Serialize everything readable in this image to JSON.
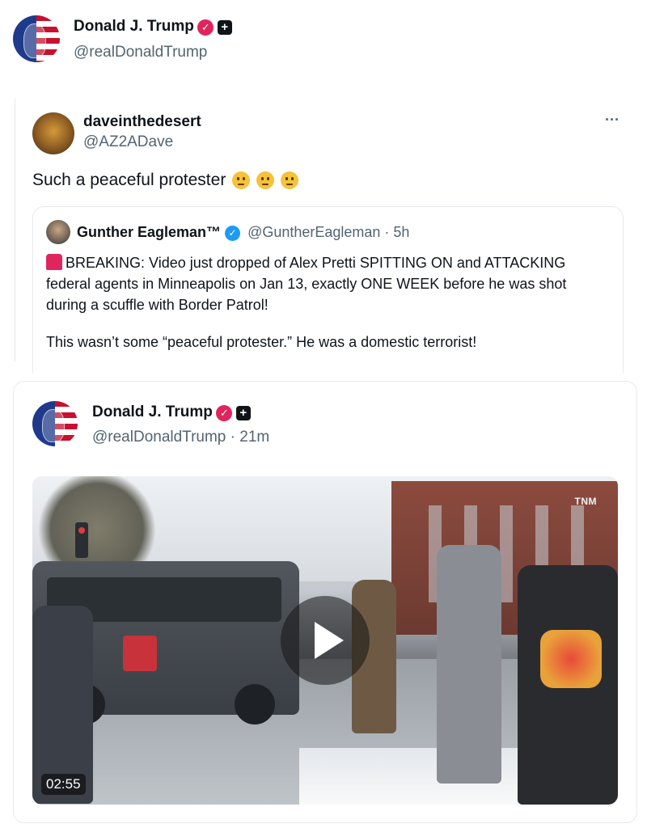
{
  "header": {
    "name": "Donald J. Trump",
    "handle": "@realDonaldTrump"
  },
  "repost": {
    "name": "daveinthedesert",
    "handle": "@AZ2ADave",
    "more": "···",
    "text": "Such a peaceful protester"
  },
  "quoted": {
    "name": "Gunther Eagleman™",
    "handle_time": "@GuntherEagleman · 5h",
    "line1": "BREAKING: Video just dropped of Alex Pretti SPITTING ON and ATTACKING",
    "line2": "federal agents in Minneapolis on Jan 13, exactly ONE WEEK before he was shot",
    "line3": "during a scuffle with Border Patrol!",
    "line4": "This wasn’t some “peaceful protester.” He was a domestic terrorist!"
  },
  "post": {
    "name": "Donald J. Trump",
    "handle_time": "@realDonaldTrump · 21m",
    "video": {
      "duration": "02:55",
      "watermark": "TNM"
    }
  },
  "colors": {
    "verified_pink": "#e0245e",
    "verified_blue": "#1d9bf0",
    "secondary_text": "#536471"
  },
  "icons": [
    "verified-badge-icon",
    "plus-badge-icon",
    "more-options-icon",
    "play-icon",
    "thinking-emoji-icon",
    "eye-roll-emoji-icon",
    "siren-emoji-icon"
  ]
}
